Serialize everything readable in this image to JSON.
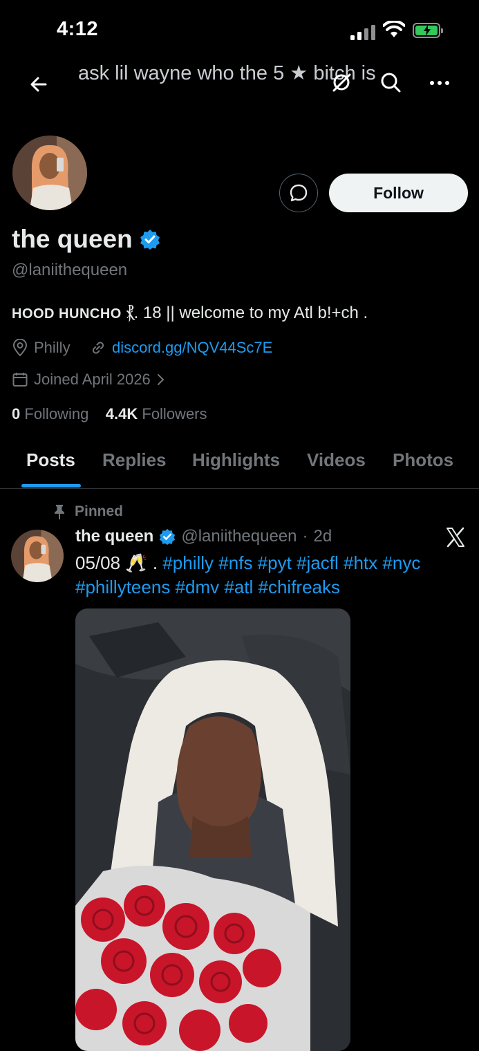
{
  "status_bar": {
    "time": "4:12"
  },
  "header": {
    "title": "ask lil wayne who the 5 ★ bitch is"
  },
  "profile": {
    "display_name": "the queen",
    "handle": "@laniithequeen",
    "follow_label": "Follow",
    "bio": {
      "caps": "HOOD HUNCHO",
      "glyph": "⳩",
      "rest": ". 18 || welcome to my Atl b!+ch ."
    },
    "location": "Philly",
    "website": "discord.gg/NQV44Sc7E",
    "joined": "Joined April 2026",
    "following_count": "0",
    "following_label": "Following",
    "followers_count": "4.4K",
    "followers_label": "Followers"
  },
  "tabs": [
    {
      "label": "Posts",
      "active": true
    },
    {
      "label": "Replies"
    },
    {
      "label": "Highlights"
    },
    {
      "label": "Videos"
    },
    {
      "label": "Photos"
    }
  ],
  "pinned_post": {
    "pinned_label": "Pinned",
    "author_name": "the queen",
    "author_handle": "@laniithequeen",
    "separator": "·",
    "age": "2d",
    "text_prefix": "05/08 🥂 .",
    "hashtags": [
      "#philly",
      "#nfs",
      "#pyt",
      "#jacfl",
      "#htx",
      "#nyc",
      "#phillyteens",
      "#dmv",
      "#atl",
      "#chifreaks"
    ]
  },
  "colors": {
    "background": "#000000",
    "accent": "#1d9bf0",
    "muted_text": "#71767b",
    "primary_text": "#e7e9ea"
  },
  "icons": [
    "back-arrow-icon",
    "grok-icon",
    "search-icon",
    "more-icon",
    "message-icon",
    "verified-badge-icon",
    "location-icon",
    "link-icon",
    "calendar-icon",
    "chevron-right-icon",
    "pin-icon",
    "x-logo-icon"
  ]
}
